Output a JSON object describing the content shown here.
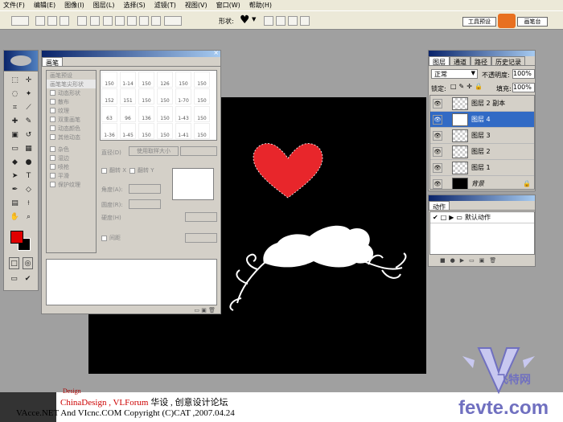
{
  "menu": [
    "文件(F)",
    "编辑(E)",
    "图像(I)",
    "图层(L)",
    "选择(S)",
    "滤镜(T)",
    "视图(V)",
    "窗口(W)",
    "帮助(H)"
  ],
  "options": {
    "shape_label": "形状:",
    "workspace_button": "工具预设",
    "palette_label": "画笔台"
  },
  "brushes_panel": {
    "tab": "画笔",
    "sidebar": [
      "画笔预设",
      "画笔笔尖形状",
      "动态形状",
      "散布",
      "纹理",
      "双重画笔",
      "动态颜色",
      "其他动态",
      "杂色",
      "湿边",
      "喷枪",
      "平滑",
      "保护纹理"
    ],
    "sizes": [
      "150",
      "1-14",
      "150",
      "126",
      "150",
      "150",
      "152",
      "151",
      "150",
      "150",
      "1-70",
      "150",
      "63",
      "96",
      "136",
      "150",
      "1-43",
      "150",
      "1-36",
      "1-45",
      "150",
      "150",
      "1-41",
      "150"
    ],
    "diameter_label": "直径(D)",
    "use_sample": "使用取样大小",
    "flip_x": "翻转 X",
    "flip_y": "翻转 Y",
    "angle_label": "角度(A):",
    "roundness_label": "圆度(R):",
    "hardness_label": "硬度(H)",
    "spacing_label": "间距"
  },
  "layers_panel": {
    "tabs": [
      "图层",
      "通道",
      "路径",
      "历史记录"
    ],
    "blend_mode": "正常",
    "opacity_label": "不透明度:",
    "opacity_value": "100%",
    "lock_label": "锁定:",
    "fill_label": "填充:",
    "fill_value": "100%",
    "layers": [
      "图层 2 副本",
      "图层 4",
      "图层 3",
      "图层 2",
      "图层 1",
      "背景"
    ],
    "selected_index": 1
  },
  "actions_panel": {
    "tab": "动作",
    "item": "默认动作"
  },
  "colors": {
    "foreground": "#e00000",
    "background": "#000000",
    "heart": "#e8262b",
    "selection": "#316ac5"
  },
  "footer": {
    "line1_a": "ChinaDesign , VLForum",
    "line1_b": "华设 , 创意设计论坛",
    "line2": "VAcce.NET  And  VIcnc.COM  Copyright (C)CAT ,2007.04.24",
    "logo_cn": "飞特网",
    "logo_url": "fevte.com",
    "ribbon": "Design"
  }
}
